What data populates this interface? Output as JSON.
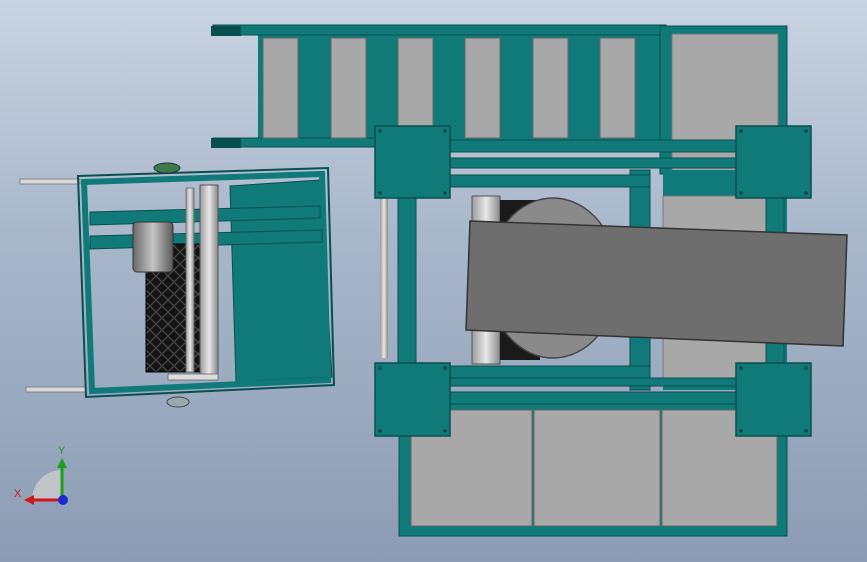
{
  "colors": {
    "frame_teal": "#0f7a78",
    "frame_dark": "#0a4f4f",
    "panel_gray": "#a8a8a8",
    "belt_gray": "#6e6e6e",
    "drum_gray": "#8a8a8a",
    "mesh_black": "#141414",
    "axis_x": "#d01818",
    "axis_y": "#1aa01a",
    "axis_z": "#1a2ad0"
  },
  "triad": {
    "x_label": "X",
    "y_label": "Y"
  }
}
